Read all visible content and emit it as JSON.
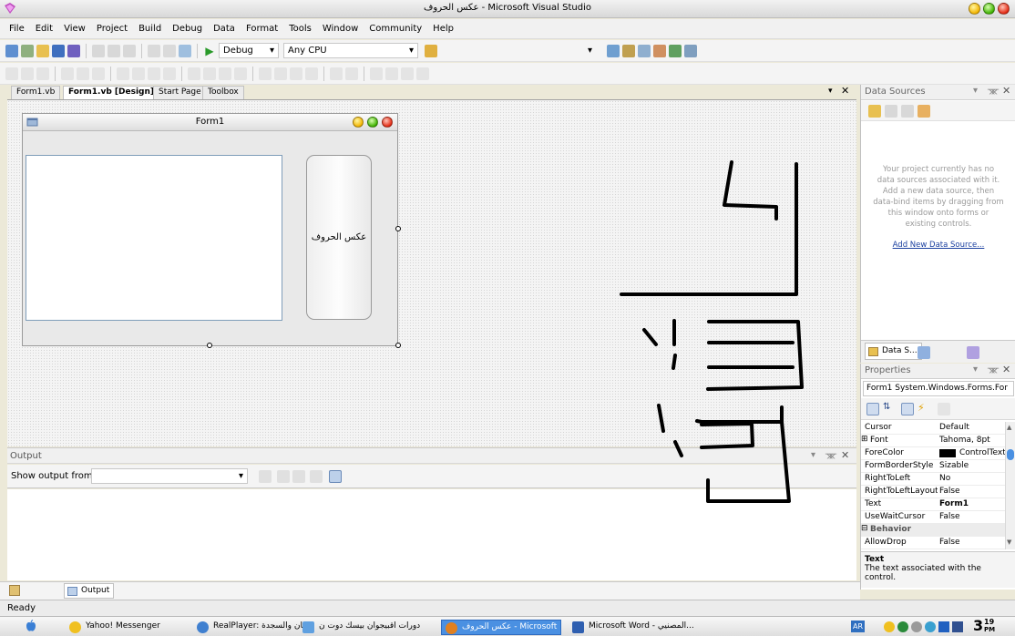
{
  "window": {
    "title": "عكس الحروف - Microsoft Visual Studio"
  },
  "menu": [
    "File",
    "Edit",
    "View",
    "Project",
    "Build",
    "Debug",
    "Data",
    "Format",
    "Tools",
    "Window",
    "Community",
    "Help"
  ],
  "toolbar": {
    "config": "Debug",
    "platform": "Any CPU",
    "find_value": ""
  },
  "doc_tabs": [
    "Form1.vb",
    "Form1.vb [Design]",
    "Start Page",
    "Toolbox"
  ],
  "designer": {
    "form_title": "Form1",
    "button_text": "عكس الحروف"
  },
  "data_sources": {
    "title": "Data Sources",
    "message": "Your project currently has no data sources associated with it. Add a new data source, then data-bind items by dragging from this window onto forms or existing controls.",
    "message_lines": [
      "Your project currently has no",
      "data sources associated with it.",
      "Add a new data source, then",
      "data-bind items by dragging from",
      "this window onto forms or",
      "existing controls."
    ],
    "add_link": "Add New Data Source...",
    "tab_label": "Data S..."
  },
  "properties": {
    "title": "Properties",
    "object": "Form1 System.Windows.Forms.For",
    "rows": [
      {
        "name": "Cursor",
        "value": "Default"
      },
      {
        "name": "Font",
        "value": "Tahoma, 8pt",
        "expand": "⊞"
      },
      {
        "name": "ForeColor",
        "value": "ControlText"
      },
      {
        "name": "FormBorderStyle",
        "value": "Sizable"
      },
      {
        "name": "RightToLeft",
        "value": "No"
      },
      {
        "name": "RightToLeftLayout",
        "value": "False"
      },
      {
        "name": "Text",
        "value": "Form1"
      },
      {
        "name": "UseWaitCursor",
        "value": "False"
      },
      {
        "name": "Behavior",
        "value": "",
        "category": true,
        "expand": "⊟"
      },
      {
        "name": "AllowDrop",
        "value": "False"
      }
    ],
    "desc_title": "Text",
    "desc_text": "The text associated with the control."
  },
  "output": {
    "title": "Output",
    "show_from_label": "Show output from:",
    "show_from_value": "",
    "tab_label": "Output"
  },
  "status": {
    "text": "Ready"
  },
  "taskbar": {
    "items": [
      {
        "label": "Yahoo! Messenger"
      },
      {
        "label": "RealPlayer: قصان والسجدة"
      },
      {
        "label": "دورات اقبيجوان بيسك دوت ن..."
      },
      {
        "label": "عكس الحروف - Microsoft ...",
        "active": true
      },
      {
        "label": "Microsoft Word - المصنيي..."
      }
    ],
    "lang": "AR",
    "time": "3",
    "time_min": "19",
    "time_ampm": "PM"
  }
}
